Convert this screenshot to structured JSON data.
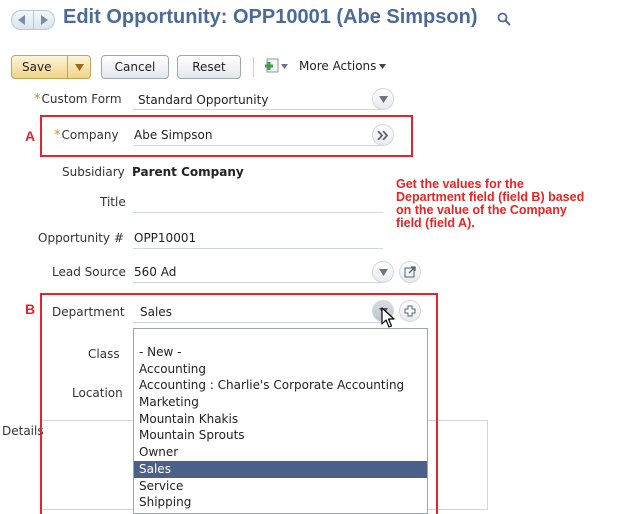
{
  "header": {
    "title": "Edit Opportunity: OPP10001 (Abe Simpson)"
  },
  "toolbar": {
    "save_label": "Save",
    "cancel_label": "Cancel",
    "reset_label": "Reset",
    "more_actions_label": "More Actions"
  },
  "form": {
    "custom_form": {
      "label": "Custom Form",
      "value": "Standard Opportunity"
    },
    "company": {
      "label": "Company",
      "value": "Abe Simpson"
    },
    "subsidiary": {
      "label": "Subsidiary",
      "value": "Parent Company"
    },
    "title": {
      "label": "Title",
      "value": ""
    },
    "opportunity_number": {
      "label": "Opportunity #",
      "value": "OPP10001"
    },
    "lead_source": {
      "label": "Lead Source",
      "value": "560 Ad"
    },
    "department": {
      "label": "Department",
      "value": "Sales"
    },
    "class": {
      "label": "Class"
    },
    "location": {
      "label": "Location"
    },
    "details": {
      "label": "Details"
    }
  },
  "annotations": {
    "marker_a": "A",
    "marker_b": "B",
    "note_lines": [
      "Get the values for the",
      "Department field (field B) based",
      "on the value of the Company",
      "field (field A)."
    ]
  },
  "department_dropdown": {
    "options": [
      "- New -",
      "Accounting",
      "Accounting : Charlie's Corporate Accounting",
      "Marketing",
      "Mountain Khakis",
      "Mountain Sprouts",
      "Owner",
      "Sales",
      "Service",
      "Shipping"
    ],
    "selected": "Sales"
  },
  "colors": {
    "title": "#4a6a9c",
    "annotation_red": "#e4242b",
    "required_star": "#e88a00",
    "selected_option_bg": "#4a6089"
  }
}
